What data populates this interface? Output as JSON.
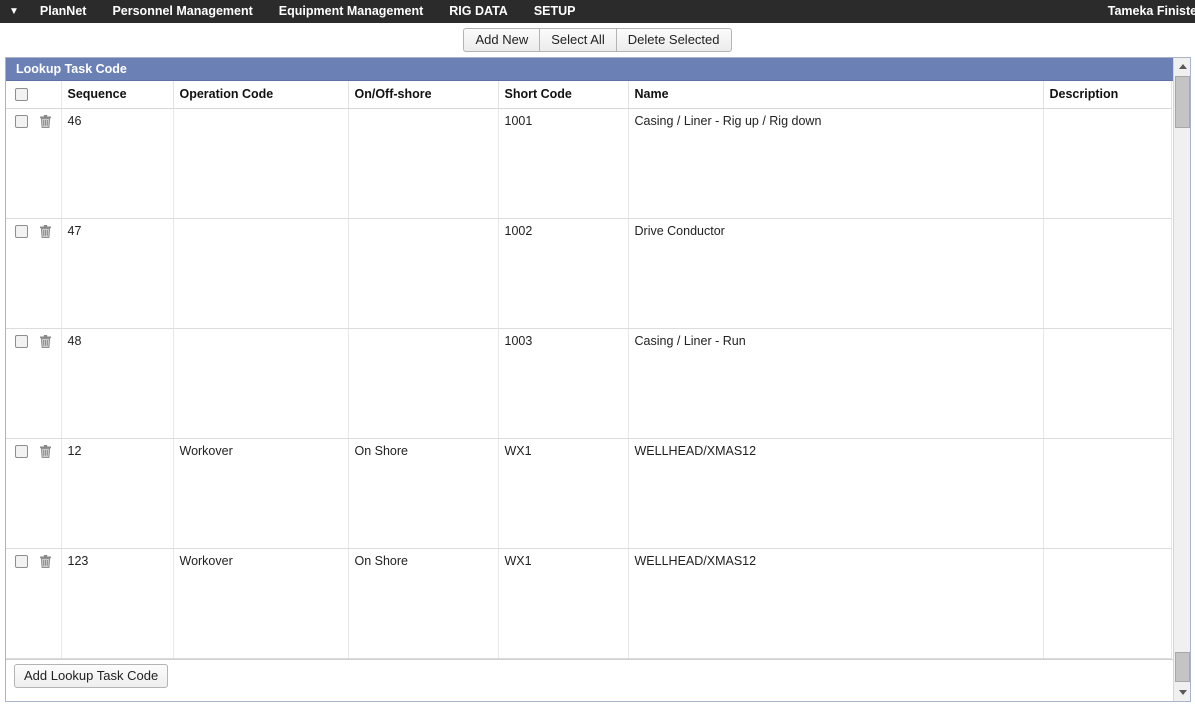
{
  "topnav": {
    "caret_icon": "chevron-down-icon",
    "brand": "PlanNet",
    "items": [
      {
        "label": "Personnel Management"
      },
      {
        "label": "Equipment Management"
      },
      {
        "label": "RIG DATA"
      },
      {
        "label": "SETUP"
      }
    ],
    "user": "Tameka Finister"
  },
  "toolbar": {
    "add_new": "Add New",
    "select_all": "Select All",
    "delete_selected": "Delete Selected"
  },
  "panel": {
    "title": "Lookup Task Code",
    "title_bg": "#6b80b5",
    "add_button": "Add Lookup Task Code"
  },
  "grid": {
    "columns": [
      {
        "key": "select",
        "label": ""
      },
      {
        "key": "sequence",
        "label": "Sequence"
      },
      {
        "key": "operation_code",
        "label": "Operation Code"
      },
      {
        "key": "on_off_shore",
        "label": "On/Off-shore"
      },
      {
        "key": "short_code",
        "label": "Short Code"
      },
      {
        "key": "name",
        "label": "Name"
      },
      {
        "key": "description",
        "label": "Description"
      }
    ],
    "rows": [
      {
        "sequence": "46",
        "operation_code": "",
        "on_off_shore": "",
        "short_code": "1001",
        "name": "Casing / Liner - Rig up / Rig down",
        "description": ""
      },
      {
        "sequence": "47",
        "operation_code": "",
        "on_off_shore": "",
        "short_code": "1002",
        "name": "Drive Conductor",
        "description": ""
      },
      {
        "sequence": "48",
        "operation_code": "",
        "on_off_shore": "",
        "short_code": "1003",
        "name": "Casing / Liner - Run",
        "description": ""
      },
      {
        "sequence": "12",
        "operation_code": "Workover",
        "on_off_shore": "On Shore",
        "short_code": "WX1",
        "name": "WELLHEAD/XMAS12",
        "description": ""
      },
      {
        "sequence": "123",
        "operation_code": "Workover",
        "on_off_shore": "On Shore",
        "short_code": "WX1",
        "name": "WELLHEAD/XMAS12",
        "description": ""
      }
    ],
    "row_icons": {
      "select_checkbox": "checkbox-icon",
      "delete": "trash-icon"
    }
  },
  "scrollbar": {
    "up_arrow_icon": "triangle-up-icon",
    "down_arrow_icon": "triangle-down-icon"
  }
}
